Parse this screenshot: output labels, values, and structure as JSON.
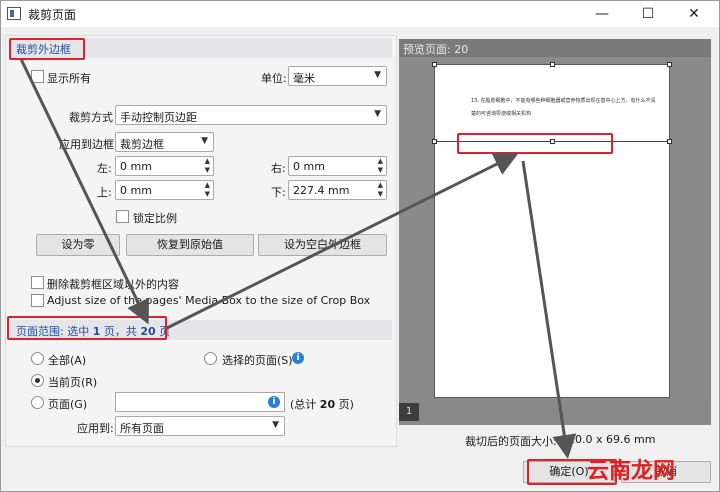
{
  "window": {
    "title": "裁剪页面",
    "minimize": "—",
    "maximize": "☐",
    "close": "✕"
  },
  "crop_section": {
    "title": "裁剪外边框",
    "show_all": "显示所有",
    "unit_label": "单位:",
    "unit_value": "毫米",
    "crop_mode_label": "裁剪方式",
    "crop_mode_value": "手动控制页边距",
    "apply_to_box_label": "应用到边框",
    "apply_to_box_value": "裁剪边框",
    "left_label": "左:",
    "left_value": "0 mm",
    "right_label": "右:",
    "right_value": "0 mm",
    "top_label": "上:",
    "top_value": "0 mm",
    "bottom_label": "下:",
    "bottom_value": "227.4 mm",
    "lock_ratio": "锁定比例",
    "btn_zero": "设为零",
    "btn_restore": "恢复到原始值",
    "btn_blank": "设为空白外边框",
    "delete_outside": "删除裁剪框区域以外的内容",
    "adjust_media": "Adjust size of the pages' Media Box to the size of Crop Box"
  },
  "range_section": {
    "title_prefix": "页面范围: 选中 ",
    "selected": "1",
    "title_mid": " 页，共 ",
    "total": "20",
    "title_suffix": " 页",
    "all": "全部(A)",
    "selected_pages": "选择的页面(S)",
    "current_page": "当前页(R)",
    "pages": "页面(G)",
    "pages_value": "",
    "total_prefix": "(总计 ",
    "total_count": "20",
    "total_suffix": " 页)",
    "apply_to_label": "应用到:",
    "apply_to_value": "所有页面"
  },
  "preview": {
    "title": "预览页面: 20",
    "line1": "13. 在脂肪细胞中，不能有哪些种细胞器或营养物质出现在基中心上方，有什么不清",
    "line2": "楚的可咨询导游或相关机构",
    "page_number": "1",
    "result_size_label": "裁切后的页面大小:",
    "result_size_value": "210.0 x 69.6 mm"
  },
  "footer": {
    "ok": "确定(O)",
    "cancel": "取消",
    "watermark": "云南龙网"
  },
  "colors": {
    "highlight": "#e0202a",
    "section_text": "#1f4e9c"
  }
}
